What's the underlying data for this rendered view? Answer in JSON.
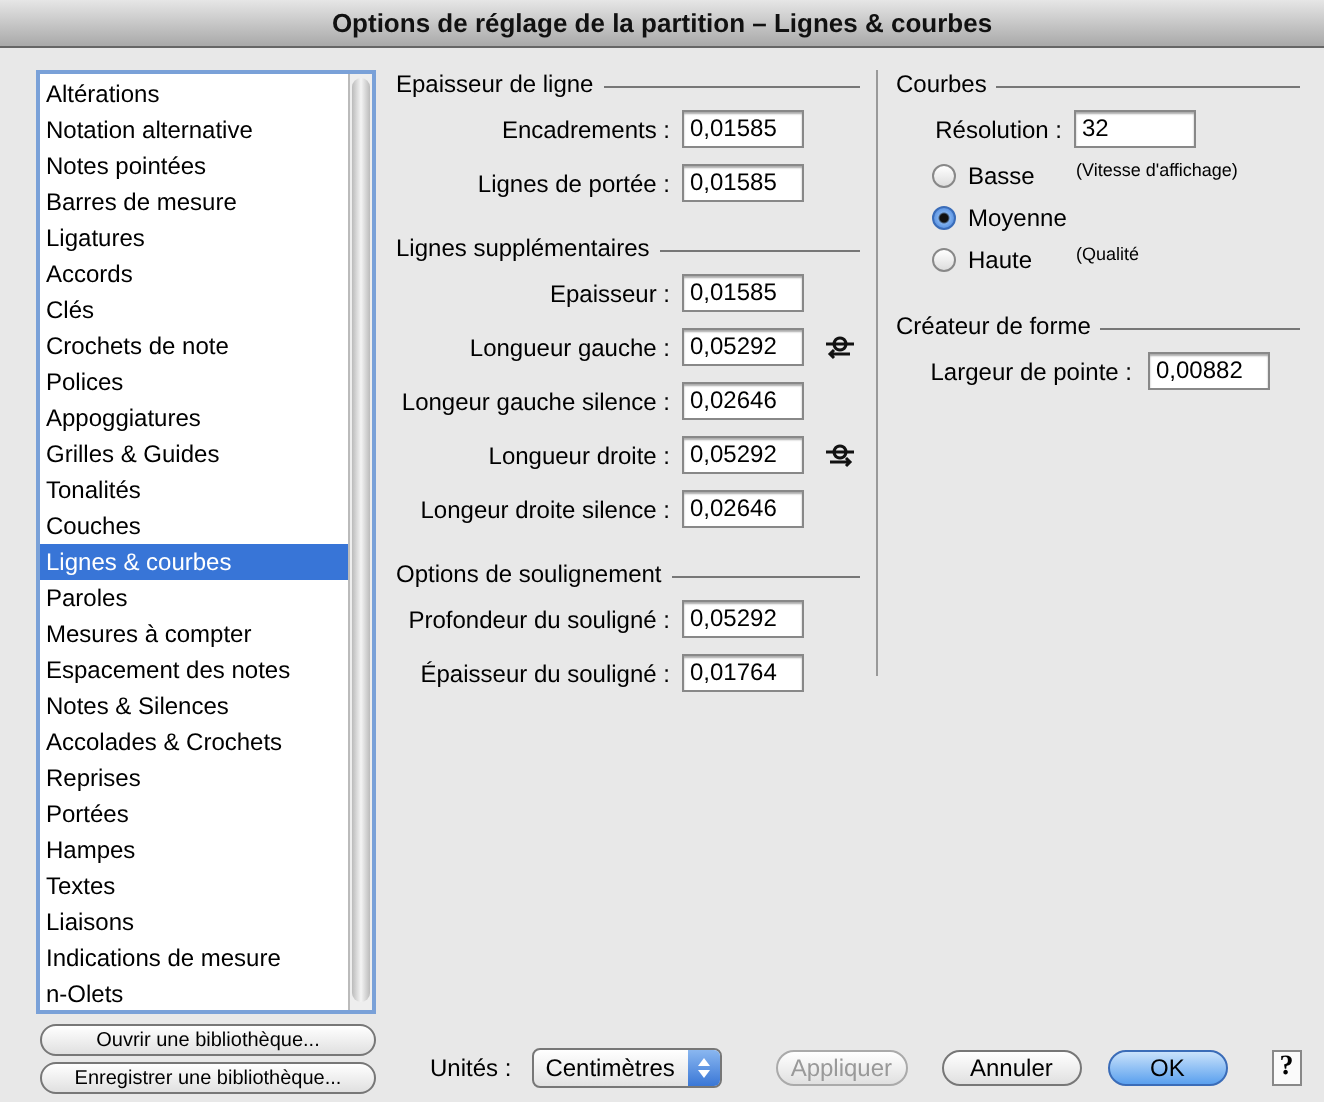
{
  "window": {
    "title": "Options de réglage de la partition – Lignes & courbes"
  },
  "sidebar": {
    "items": [
      {
        "label": "Altérations",
        "selected": false
      },
      {
        "label": "Notation alternative",
        "selected": false
      },
      {
        "label": "Notes pointées",
        "selected": false
      },
      {
        "label": "Barres de mesure",
        "selected": false
      },
      {
        "label": "Ligatures",
        "selected": false
      },
      {
        "label": "Accords",
        "selected": false
      },
      {
        "label": "Clés",
        "selected": false
      },
      {
        "label": "Crochets de note",
        "selected": false
      },
      {
        "label": "Polices",
        "selected": false
      },
      {
        "label": "Appoggiatures",
        "selected": false
      },
      {
        "label": "Grilles & Guides",
        "selected": false
      },
      {
        "label": "Tonalités",
        "selected": false
      },
      {
        "label": "Couches",
        "selected": false
      },
      {
        "label": "Lignes & courbes",
        "selected": true
      },
      {
        "label": "Paroles",
        "selected": false
      },
      {
        "label": "Mesures à compter",
        "selected": false
      },
      {
        "label": "Espacement des notes",
        "selected": false
      },
      {
        "label": "Notes & Silences",
        "selected": false
      },
      {
        "label": "Accolades & Crochets",
        "selected": false
      },
      {
        "label": "Reprises",
        "selected": false
      },
      {
        "label": "Portées",
        "selected": false
      },
      {
        "label": "Hampes",
        "selected": false
      },
      {
        "label": "Textes",
        "selected": false
      },
      {
        "label": "Liaisons",
        "selected": false
      },
      {
        "label": "Indications de mesure",
        "selected": false
      },
      {
        "label": "n-Olets",
        "selected": false
      }
    ]
  },
  "library_buttons": [
    "Ouvrir une bibliothèque...",
    "Enregistrer une bibliothèque..."
  ],
  "sections": [
    {
      "title": "Epaisseur de ligne",
      "fields": [
        {
          "label": "Encadrements :",
          "value": "0,01585",
          "kind": "plain"
        },
        {
          "label": "Lignes de portée :",
          "value": "0,01585",
          "kind": "plain"
        }
      ]
    },
    {
      "title": "Lignes supplémentaires",
      "fields": [
        {
          "label": "Epaisseur :",
          "value": "0,01585",
          "kind": "plain"
        },
        {
          "label": "Longueur gauche :",
          "value": "0,05292",
          "kind": "extend-left"
        },
        {
          "label": "Longeur gauche silence :",
          "value": "0,02646",
          "kind": "plain"
        },
        {
          "label": "Longueur droite :",
          "value": "0,05292",
          "kind": "extend-right"
        },
        {
          "label": "Longeur droite silence :",
          "value": "0,02646",
          "kind": "plain"
        }
      ]
    },
    {
      "title": "Options de soulignement",
      "fields": [
        {
          "label": "Profondeur du souligné :",
          "value": "0,05292",
          "kind": "plain"
        },
        {
          "label": "Épaisseur du souligné :",
          "value": "0,01764",
          "kind": "plain"
        }
      ]
    }
  ],
  "curves": {
    "title": "Courbes",
    "resolution": {
      "label": "Résolution :",
      "value": "32"
    },
    "options": [
      {
        "label": "Basse",
        "note": "(Vitesse d'affichage)",
        "selected": false
      },
      {
        "label": "Moyenne",
        "selected": true
      },
      {
        "label": "Haute",
        "note": "(Qualité",
        "selected": false
      }
    ]
  },
  "shape_creator": {
    "title": "Créateur de forme",
    "fields": [
      {
        "label": "Largeur de pointe :",
        "value": "0,00882"
      }
    ]
  },
  "footer": {
    "units_label": "Unités :",
    "units_value": "Centimètres",
    "buttons": [
      {
        "label": "Appliquer",
        "disabled": true,
        "default": false
      },
      {
        "label": "Annuler",
        "disabled": false,
        "default": false
      },
      {
        "label": "OK",
        "disabled": false,
        "default": true
      }
    ],
    "help": "?"
  }
}
